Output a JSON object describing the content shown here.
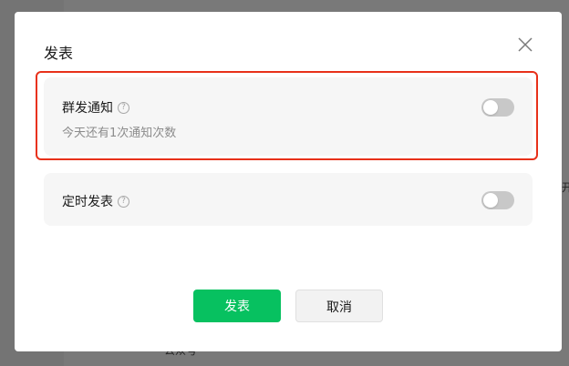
{
  "background": {
    "right_fragment": "开",
    "bottom_fragment": "公众号"
  },
  "dialog": {
    "title": "发表",
    "close_icon": "close-icon",
    "options": [
      {
        "label": "群发通知",
        "help_icon": "?",
        "subtext": "今天还有1次通知次数",
        "enabled": false
      },
      {
        "label": "定时发表",
        "help_icon": "?",
        "enabled": false
      }
    ],
    "buttons": {
      "publish": "发表",
      "cancel": "取消"
    }
  },
  "colors": {
    "primary_green": "#07c160",
    "highlight_red": "#e8311a",
    "toggle_off": "#c8c8c8"
  }
}
